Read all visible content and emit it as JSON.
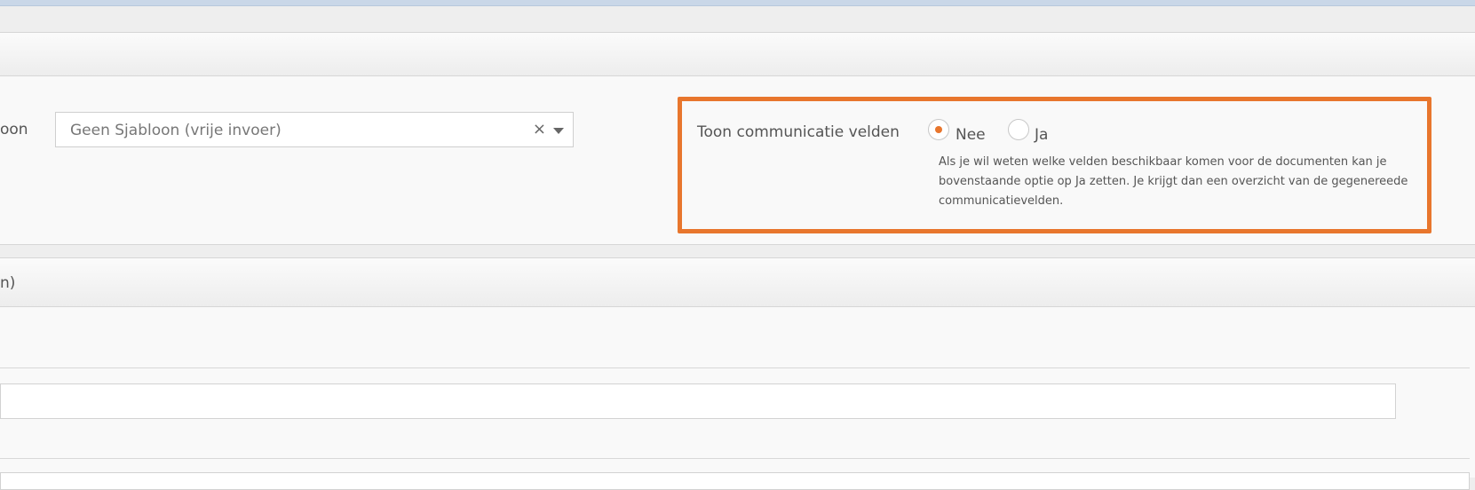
{
  "section1": {
    "template_label": "oon",
    "template_select": {
      "value": "Geen Sjabloon (vrije invoer)",
      "clear_symbol": "×"
    },
    "communication_fields": {
      "label": "Toon communicatie velden",
      "options": [
        {
          "label": "Nee",
          "selected": true
        },
        {
          "label": "Ja",
          "selected": false
        }
      ],
      "help_text": "Als je wil weten welke velden beschikbaar komen voor de documenten kan je bovenstaande optie op Ja zetten. Je krijgt dan een overzicht van de gegenereede communicatievelden."
    }
  },
  "section2": {
    "header_title": "n)"
  },
  "colors": {
    "accent": "#e8762d",
    "panel_bg": "#f9f9f9",
    "border": "#d6d6d6"
  }
}
